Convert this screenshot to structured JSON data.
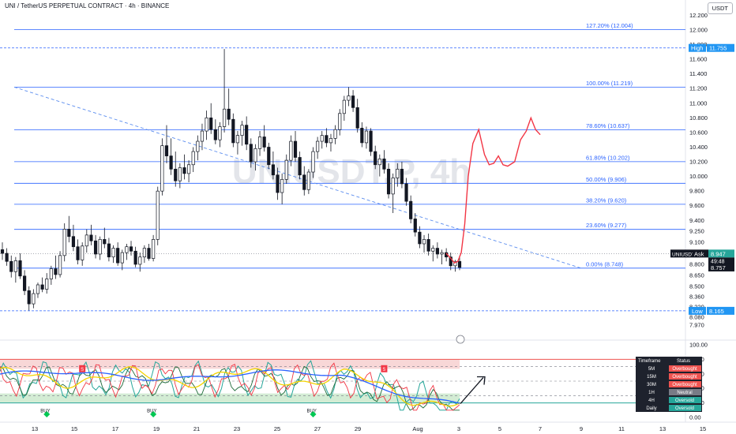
{
  "header": {
    "title": "UNI / TetherUS PERPETUAL CONTRACT · 4h · BINANCE",
    "currency": "USDT"
  },
  "watermark": "UNIUSDT.P, 4h",
  "chart_data": {
    "type": "candlestick",
    "symbol": "UNIUSDT.P",
    "timeframe": "4h",
    "price_axis": {
      "ticks": [
        12.2,
        12.0,
        11.8,
        11.6,
        11.4,
        11.2,
        11.0,
        10.8,
        10.6,
        10.4,
        10.2,
        10.0,
        9.8,
        9.6,
        9.4,
        9.25,
        9.1,
        8.95,
        8.8,
        8.65,
        8.5,
        8.36,
        8.22,
        8.08,
        7.97
      ],
      "range": [
        7.97,
        12.28
      ]
    },
    "fibonacci": [
      {
        "label": "127.20% (12.004)",
        "value": 12.004
      },
      {
        "label": "100.00% (11.219)",
        "value": 11.219
      },
      {
        "label": "78.60% (10.637)",
        "value": 10.637
      },
      {
        "label": "61.80% (10.202)",
        "value": 10.202
      },
      {
        "label": "50.00% (9.906)",
        "value": 9.906
      },
      {
        "label": "38.20% (9.620)",
        "value": 9.62
      },
      {
        "label": "23.60% (9.277)",
        "value": 9.277
      },
      {
        "label": "0.00% (8.748)",
        "value": 8.748
      }
    ],
    "markers": {
      "high": {
        "label": "High",
        "value": 11.755,
        "text": "11.755"
      },
      "low": {
        "label": "Low",
        "value": 8.165,
        "text": "8.165"
      },
      "ask": {
        "label": "UNIUSDT.P",
        "tag": "Ask",
        "value": 8.947,
        "text": "8.947",
        "countdown": "49:48"
      },
      "last": {
        "value": 8.757,
        "text": "8.757"
      }
    },
    "x_axis": {
      "labels": [
        "13",
        "15",
        "17",
        "19",
        "21",
        "23",
        "25",
        "27",
        "29",
        "Aug",
        "3",
        "5",
        "7",
        "9",
        "11",
        "13",
        "15"
      ]
    },
    "ohlc": [
      [
        9.0,
        9.1,
        8.86,
        8.95
      ],
      [
        8.95,
        9.02,
        8.78,
        8.84
      ],
      [
        8.84,
        8.92,
        8.62,
        8.7
      ],
      [
        8.7,
        8.9,
        8.55,
        8.85
      ],
      [
        8.85,
        8.95,
        8.6,
        8.64
      ],
      [
        8.64,
        8.72,
        8.38,
        8.44
      ],
      [
        8.44,
        8.5,
        8.17,
        8.26
      ],
      [
        8.26,
        8.46,
        8.2,
        8.4
      ],
      [
        8.4,
        8.55,
        8.34,
        8.52
      ],
      [
        8.52,
        8.62,
        8.42,
        8.46
      ],
      [
        8.46,
        8.68,
        8.4,
        8.6
      ],
      [
        8.6,
        8.78,
        8.52,
        8.74
      ],
      [
        8.74,
        8.92,
        8.6,
        8.66
      ],
      [
        8.66,
        8.98,
        8.62,
        8.92
      ],
      [
        8.92,
        9.36,
        8.84,
        9.28
      ],
      [
        9.28,
        9.46,
        9.1,
        9.18
      ],
      [
        9.18,
        9.34,
        8.98,
        9.04
      ],
      [
        9.04,
        9.14,
        8.8,
        8.86
      ],
      [
        8.86,
        9.1,
        8.78,
        9.05
      ],
      [
        9.05,
        9.28,
        8.96,
        9.2
      ],
      [
        9.2,
        9.34,
        9.06,
        9.12
      ],
      [
        9.12,
        9.2,
        8.88,
        8.94
      ],
      [
        8.94,
        9.18,
        8.86,
        9.14
      ],
      [
        9.14,
        9.3,
        9.02,
        9.08
      ],
      [
        9.08,
        9.16,
        8.84,
        8.9
      ],
      [
        8.9,
        9.06,
        8.82,
        9.02
      ],
      [
        9.02,
        9.1,
        8.78,
        8.82
      ],
      [
        8.82,
        9.0,
        8.72,
        8.96
      ],
      [
        8.96,
        9.08,
        8.86,
        9.04
      ],
      [
        9.04,
        9.12,
        8.92,
        8.98
      ],
      [
        8.98,
        9.04,
        8.76,
        8.8
      ],
      [
        8.8,
        8.96,
        8.7,
        8.9
      ],
      [
        8.9,
        9.06,
        8.82,
        9.02
      ],
      [
        9.02,
        9.08,
        8.85,
        8.88
      ],
      [
        8.88,
        9.2,
        8.84,
        9.14
      ],
      [
        9.14,
        9.86,
        9.06,
        9.8
      ],
      [
        9.8,
        10.52,
        9.74,
        10.42
      ],
      [
        10.42,
        10.7,
        10.18,
        10.28
      ],
      [
        10.28,
        10.52,
        10.02,
        10.1
      ],
      [
        10.1,
        10.34,
        9.86,
        9.94
      ],
      [
        9.94,
        10.18,
        9.84,
        10.12
      ],
      [
        10.12,
        10.3,
        9.96,
        10.04
      ],
      [
        10.04,
        10.22,
        9.92,
        10.16
      ],
      [
        10.16,
        10.4,
        10.06,
        10.34
      ],
      [
        10.34,
        10.56,
        10.22,
        10.48
      ],
      [
        10.48,
        10.72,
        10.36,
        10.62
      ],
      [
        10.62,
        10.9,
        10.5,
        10.8
      ],
      [
        10.8,
        11.0,
        10.58,
        10.64
      ],
      [
        10.64,
        10.78,
        10.44,
        10.5
      ],
      [
        10.5,
        10.74,
        10.4,
        10.68
      ],
      [
        10.68,
        11.74,
        10.6,
        10.92
      ],
      [
        10.92,
        11.2,
        10.7,
        10.78
      ],
      [
        10.78,
        10.86,
        10.4,
        10.46
      ],
      [
        10.46,
        10.62,
        10.3,
        10.56
      ],
      [
        10.56,
        10.76,
        10.42,
        10.7
      ],
      [
        10.7,
        10.82,
        10.36,
        10.44
      ],
      [
        10.44,
        10.52,
        10.12,
        10.2
      ],
      [
        10.2,
        10.44,
        10.08,
        10.38
      ],
      [
        10.38,
        10.62,
        10.28,
        10.54
      ],
      [
        10.54,
        10.7,
        10.34,
        10.4
      ],
      [
        10.4,
        10.46,
        10.1,
        10.16
      ],
      [
        10.16,
        10.34,
        9.96,
        10.02
      ],
      [
        10.02,
        10.12,
        9.68,
        9.78
      ],
      [
        9.78,
        10.04,
        9.62,
        9.96
      ],
      [
        9.96,
        10.3,
        9.9,
        10.22
      ],
      [
        10.22,
        10.56,
        10.14,
        10.48
      ],
      [
        10.48,
        10.62,
        10.2,
        10.26
      ],
      [
        10.26,
        10.34,
        9.96,
        10.02
      ],
      [
        10.02,
        10.14,
        9.74,
        9.82
      ],
      [
        9.82,
        10.1,
        9.76,
        10.06
      ],
      [
        10.06,
        10.4,
        9.98,
        10.34
      ],
      [
        10.34,
        10.54,
        10.24,
        10.48
      ],
      [
        10.48,
        10.62,
        10.38,
        10.56
      ],
      [
        10.56,
        10.66,
        10.4,
        10.46
      ],
      [
        10.46,
        10.58,
        10.34,
        10.52
      ],
      [
        10.52,
        10.7,
        10.44,
        10.64
      ],
      [
        10.64,
        10.92,
        10.56,
        10.86
      ],
      [
        10.86,
        11.1,
        10.76,
        11.04
      ],
      [
        11.04,
        11.22,
        10.96,
        11.1
      ],
      [
        11.1,
        11.18,
        10.88,
        10.94
      ],
      [
        10.94,
        11.06,
        10.6,
        10.66
      ],
      [
        10.66,
        10.74,
        10.4,
        10.46
      ],
      [
        10.46,
        10.68,
        10.38,
        10.62
      ],
      [
        10.62,
        10.66,
        10.28,
        10.34
      ],
      [
        10.34,
        10.42,
        10.1,
        10.16
      ],
      [
        10.16,
        10.3,
        10.0,
        10.24
      ],
      [
        10.24,
        10.36,
        10.04,
        10.1
      ],
      [
        10.1,
        10.18,
        9.7,
        9.76
      ],
      [
        9.76,
        10.04,
        9.5,
        9.98
      ],
      [
        9.98,
        10.18,
        9.86,
        10.1
      ],
      [
        10.1,
        10.2,
        9.84,
        9.9
      ],
      [
        9.9,
        9.98,
        9.6,
        9.66
      ],
      [
        9.66,
        9.74,
        9.36,
        9.42
      ],
      [
        9.42,
        9.5,
        9.18,
        9.24
      ],
      [
        9.24,
        9.32,
        9.02,
        9.08
      ],
      [
        9.08,
        9.2,
        8.96,
        9.14
      ],
      [
        9.14,
        9.22,
        8.92,
        8.98
      ],
      [
        8.98,
        9.06,
        8.84,
        9.02
      ],
      [
        9.02,
        9.1,
        8.88,
        8.94
      ],
      [
        8.94,
        9.0,
        8.8,
        8.96
      ],
      [
        8.96,
        9.02,
        8.84,
        8.9
      ],
      [
        8.9,
        8.96,
        8.72,
        8.78
      ],
      [
        8.78,
        8.86,
        8.7,
        8.84
      ],
      [
        8.84,
        8.92,
        8.72,
        8.757
      ]
    ],
    "projection": [
      [
        0,
        8.95
      ],
      [
        4,
        8.88
      ],
      [
        7,
        8.82
      ],
      [
        10,
        8.84
      ],
      [
        13,
        8.96
      ],
      [
        16,
        9.35
      ],
      [
        19,
        10.0
      ],
      [
        23,
        10.45
      ],
      [
        28,
        10.64
      ],
      [
        33,
        10.3
      ],
      [
        37,
        10.16
      ],
      [
        41,
        10.18
      ],
      [
        45,
        10.28
      ],
      [
        49,
        10.16
      ],
      [
        53,
        10.14
      ],
      [
        59,
        10.2
      ],
      [
        64,
        10.5
      ],
      [
        69,
        10.62
      ],
      [
        73,
        10.8
      ],
      [
        77,
        10.64
      ],
      [
        81,
        10.57
      ]
    ],
    "indicator": {
      "y_ticks": [
        "100.00",
        "80.00",
        "60.00",
        "40.00",
        "20.00",
        "0.00"
      ],
      "table": {
        "headers": [
          "Timeframe",
          "Status"
        ],
        "rows": [
          {
            "tf": "5M",
            "status": "Overbought",
            "color": "#ef5350"
          },
          {
            "tf": "15M",
            "status": "Overbought",
            "color": "#ef5350"
          },
          {
            "tf": "30M",
            "status": "Overbought",
            "color": "#ef5350"
          },
          {
            "tf": "1H",
            "status": "Neutral",
            "color": "#787b86"
          },
          {
            "tf": "4H",
            "status": "Oversold",
            "color": "#26a69a"
          },
          {
            "tf": "Daily",
            "status": "Oversold",
            "color": "#26a69a"
          }
        ]
      },
      "signals": [
        {
          "label": "BUY",
          "type": "buy",
          "index": 10
        },
        {
          "label": "BUY",
          "type": "buy",
          "index": 34
        },
        {
          "label": "BUY",
          "type": "buy",
          "index": 70
        },
        {
          "label": "S",
          "type": "sell",
          "index": 18
        },
        {
          "label": "S",
          "type": "sell",
          "index": 86
        }
      ]
    },
    "colors": {
      "up": "#26a69a",
      "down": "#131722",
      "fib": "#2962ff",
      "projection": "#f23645",
      "trend": "#5b8def",
      "high_label": "#2196f3",
      "ask": "#131722",
      "last": "#131722"
    }
  }
}
